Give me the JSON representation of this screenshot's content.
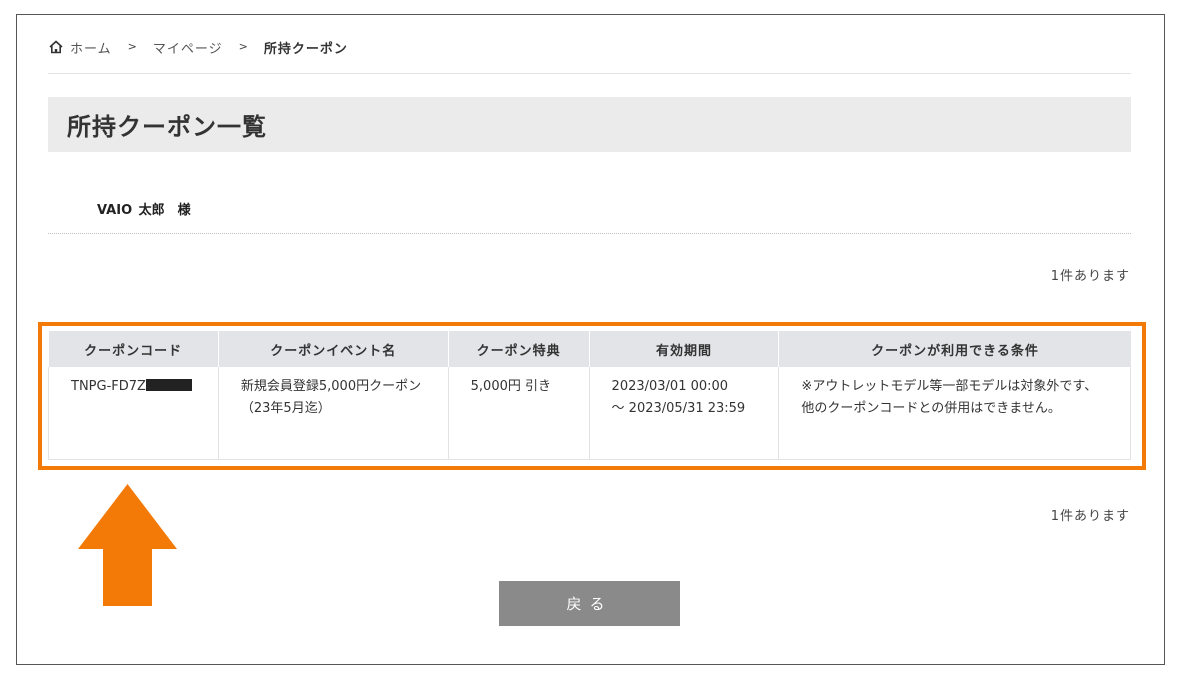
{
  "breadcrumb": {
    "home": "ホーム",
    "mypage": "マイページ",
    "current": "所持クーポン",
    "separator": ">"
  },
  "page_title": "所持クーポン一覧",
  "user": {
    "name": "VAIO 太郎　様"
  },
  "count_text": "1件あります",
  "table": {
    "headers": [
      "クーポンコード",
      "クーポンイベント名",
      "クーポン特典",
      "有効期間",
      "クーポンが利用できる条件"
    ],
    "rows": [
      {
        "code": "TNPG-FD7Z",
        "event_name": "新規会員登録5,000円クーポン（23年5月迄）",
        "benefit": "5,000円 引き",
        "period_start": "2023/03/01 00:00",
        "period_end": "～ 2023/05/31 23:59",
        "conditions": "※アウトレットモデル等一部モデルは対象外です、他のクーポンコードとの併用はできません。"
      }
    ]
  },
  "back_button": "戻る",
  "colors": {
    "highlight": "#f47a07",
    "header_bg": "#e3e4e8",
    "title_bg": "#ebebeb",
    "button_bg": "#8a8a8a"
  },
  "icons": {
    "home": "home-icon",
    "arrow": "up-arrow-icon"
  }
}
